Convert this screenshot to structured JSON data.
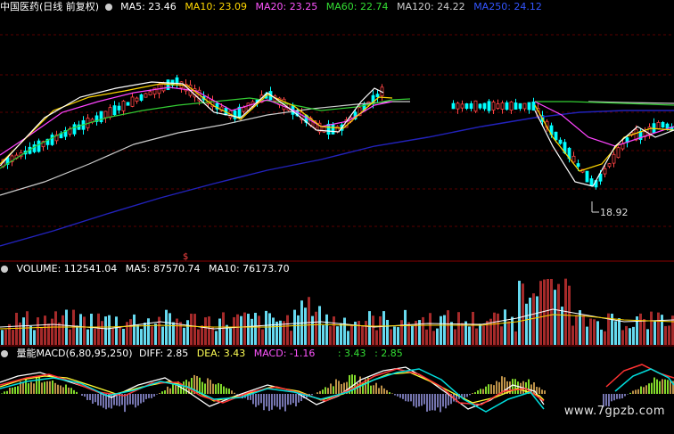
{
  "header": {
    "symbol_label": "中国医药(日线 前复权)",
    "ma": [
      {
        "label": "MA5: 23.46",
        "color": "#ffffff"
      },
      {
        "label": "MA10: 23.09",
        "color": "#ffd700"
      },
      {
        "label": "MA20: 23.25",
        "color": "#ff55ff"
      },
      {
        "label": "MA60: 22.74",
        "color": "#33dd33"
      },
      {
        "label": "MA120: 24.22",
        "color": "#cccccc"
      },
      {
        "label": "MA250: 24.12",
        "color": "#3355ff"
      }
    ]
  },
  "price_panel": {
    "low_marker": "18.92",
    "center_marker": "$"
  },
  "volume_panel": {
    "values": [
      {
        "label": "VOLUME: 112541.04",
        "color": "#ffffff"
      },
      {
        "label": "MA5: 87570.74",
        "color": "#ffffff"
      },
      {
        "label": "MA10: 76173.70",
        "color": "#ffffff"
      }
    ]
  },
  "macd_panel": {
    "title": "量能MACD(6,80,95,250)",
    "values": [
      {
        "label": "DIFF: 2.85",
        "color": "#ffffff"
      },
      {
        "label": "DEA: 3.43",
        "color": "#ffff55"
      },
      {
        "label": "MACD: -1.16",
        "color": "#ff55ff"
      },
      {
        "label": ": 3.43",
        "color": "#33dd33"
      },
      {
        "label": ": 2.85",
        "color": "#33dd33"
      }
    ]
  },
  "watermark": "www.7gpzb.com",
  "colors": {
    "up": "#ff4444",
    "down": "#00ffff",
    "grid": "#8b0000",
    "ma250": "#2222bb"
  }
}
